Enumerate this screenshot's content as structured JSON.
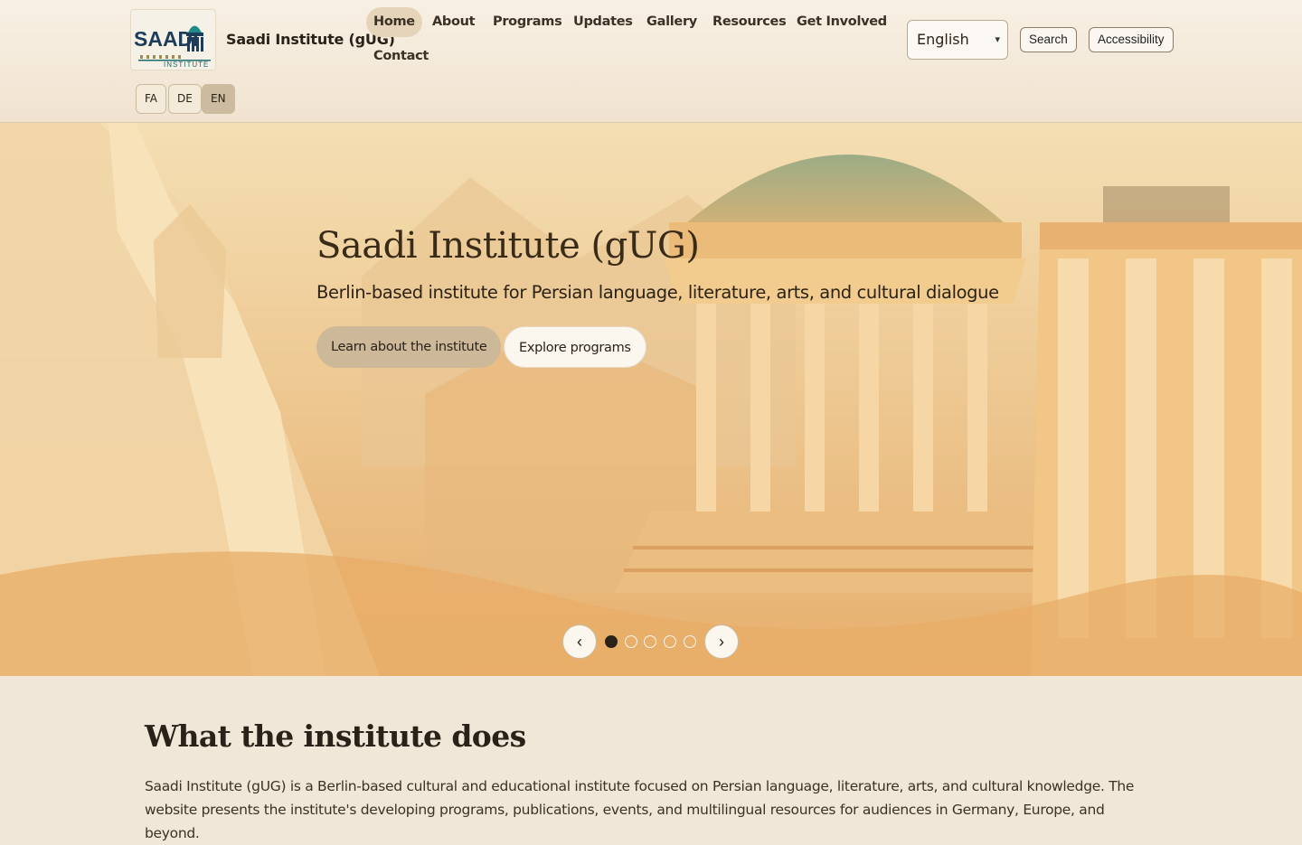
{
  "site": {
    "name": "Saadi Institute (gUG)",
    "logo_text": "SAADI",
    "logo_subtext": "INSTITUTE"
  },
  "nav": {
    "items": [
      "Home",
      "About",
      "Programs",
      "Updates",
      "Gallery",
      "Resources",
      "Get Involved",
      "Contact"
    ],
    "active": "Home"
  },
  "header": {
    "language_selected": "English",
    "search_label": "Search",
    "accessibility_label": "Accessibility",
    "lang_switch": [
      "FA",
      "DE",
      "EN"
    ],
    "lang_active": "EN"
  },
  "hero": {
    "title": "Saadi Institute (gUG)",
    "subtitle": "Berlin-based institute for Persian language, literature, arts, and cultural dialogue",
    "primary_cta": "Learn about the institute",
    "secondary_cta": "Explore programs",
    "slide_count": 5,
    "active_slide": 1
  },
  "intro": {
    "heading": "What the institute does",
    "body": "Saadi Institute (gUG) is a Berlin-based cultural and educational institute focused on Persian language, literature, arts, and cultural knowledge. The website presents the institute's developing programs, publications, events, and multilingual resources for audiences in Germany, Europe, and beyond."
  },
  "colors": {
    "header_bg": "#f5ecdf",
    "accent_tan": "#cdb99a",
    "logo_teal": "#1f6b6b",
    "logo_navy": "#1c3c5a"
  }
}
